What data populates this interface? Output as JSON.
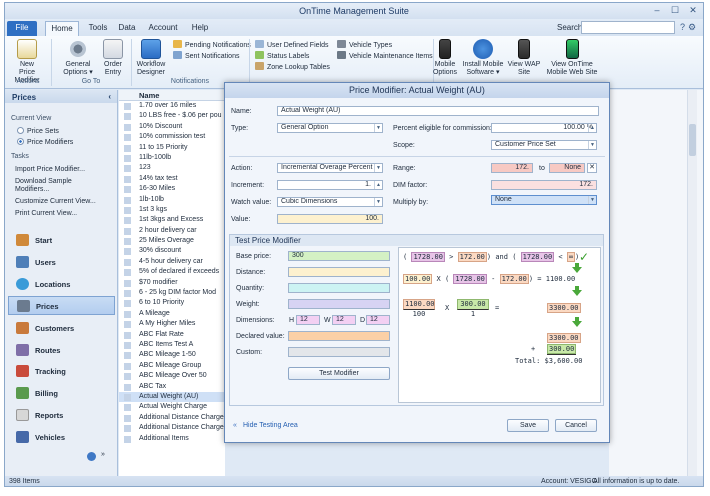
{
  "window": {
    "title": "OnTime Management Suite"
  },
  "menu": {
    "tabs": [
      "File",
      "Home",
      "Tools",
      "Data",
      "Account",
      "Help"
    ],
    "search_label": "Search:"
  },
  "ribbon": {
    "new_price_modifier": "New\nPrice Modifier",
    "general_options": "General\nOptions ▾",
    "order_entry": "Order\nEntry",
    "workflow_designer": "Workflow\nDesigner",
    "pending_notifications": "Pending Notifications",
    "sent_notifications": "Sent Notifications",
    "user_defined_fields": "User Defined Fields",
    "status_labels": "Status Labels",
    "zone_lookup_tables": "Zone Lookup Tables",
    "vehicle_types": "Vehicle Types",
    "vehicle_maintenance_items": "Vehicle Maintenance Items",
    "mobile_options": "Mobile\nOptions",
    "install_mobile_software": "Install Mobile\nSoftware ▾",
    "view_wap_site": "View WAP\nSite",
    "view_ontime_mobile_web_site": "View OnTime\nMobile Web Site",
    "groups": {
      "actions": "Actions",
      "go_to": "Go To",
      "notifications": "Notifications"
    }
  },
  "left_panel": {
    "header": "Prices",
    "current_view_label": "Current View",
    "views": [
      "Price Sets",
      "Price Modifiers"
    ],
    "tasks_label": "Tasks",
    "tasks": [
      "Import Price Modifier...",
      "Download Sample\nModifiers...",
      "Customize Current View...",
      "Print Current View..."
    ],
    "nav": [
      "Start",
      "Users",
      "Locations",
      "Prices",
      "Customers",
      "Routes",
      "Tracking",
      "Billing",
      "Reports",
      "Vehicles"
    ],
    "active_nav": "Prices"
  },
  "list": {
    "column": "Name",
    "rows": [
      "1.70 over 16 miles",
      "10 LBS free - $.06 per pou",
      "10%  Discount",
      "10% commission test",
      "11 to 15 Priority",
      "11lb-100lb",
      "123",
      "14% tax test",
      "16-30 Miles",
      "1lb-10lb",
      "1st 3 kgs",
      "1st 3kgs and Excess",
      "2 hour delivery car",
      "25 Miles Overage",
      "30% discount",
      "4-5 hour delivery car",
      "5% of declared if exceeds",
      "$70 modifier",
      "6 - 25 kg DIM factor Mod",
      "6 to 10 Priority",
      "A Mileage",
      "A My Higher Miles",
      "ABC Flat Rate",
      "ABC Items Test A",
      "ABC Mileage 1-50",
      "ABC Mileage Group",
      "ABC Mileage Over 50",
      "ABC Tax",
      "Actual Weight (AU)",
      "Actual Weight Charge",
      "Additional Distance Charges (Over 10)",
      "Additional Distance Charges (Over 10)",
      "Additional Items"
    ]
  },
  "status_bar": {
    "items": "398 Items",
    "account": "Account: VESIGO",
    "info": "All information is up to date."
  },
  "dialog": {
    "title": "Price Modifier: Actual Weight (AU)",
    "name_label": "Name:",
    "name_value": "Actual Weight (AU)",
    "type_label": "Type:",
    "type_value": "General Option",
    "commission_label": "Percent eligible for commission:",
    "commission_value": "100.00 %",
    "scope_label": "Scope:",
    "scope_value": "Customer Price Set",
    "action_label": "Action:",
    "action_value": "Incremental Overage Percent",
    "range_label": "Range:",
    "range_from": "172.",
    "range_to_label": "to",
    "range_to": "None",
    "increment_label": "Increment:",
    "increment_value": "1.",
    "dim_label": "DIM factor:",
    "dim_value": "172.",
    "watch_label": "Watch value:",
    "watch_value": "Cubic Dimensions",
    "multiply_label": "Multiply by:",
    "multiply_value": "None",
    "value_label": "Value:",
    "value_value": "100.",
    "test": {
      "header": "Test Price Modifier",
      "base_price_label": "Base price:",
      "base_price_value": "300",
      "distance_label": "Distance:",
      "quantity_label": "Quantity:",
      "weight_label": "Weight:",
      "dimensions_label": "Dimensions:",
      "h_label": "H",
      "h_value": "12",
      "w_label": "W",
      "w_value": "12",
      "d_label": "D",
      "d_value": "12",
      "declared_label": "Declared value:",
      "custom_label": "Custom:",
      "button": "Test Modifier",
      "calc": {
        "l1_a": "1728.00",
        "l1_gt": ">",
        "l1_b": "172.00",
        "l1_and": "and",
        "l1_c": "1728.00",
        "l1_lt": "<",
        "l1_d": "∞",
        "l1_check": "✓",
        "l2_a": "100.00",
        "l2_x": "X",
        "l2_b": "1728.00",
        "l2_minus": "-",
        "l2_c": "172.00",
        "l2_eq": "= 1100.00",
        "l3_num": "1100.00",
        "l3_den": "100",
        "l3_x": "X",
        "l3_num2": "300.00",
        "l3_den2": "1",
        "l3_eq": "=",
        "l3_res": "3300.00",
        "l4_a": "3300.00",
        "l4_plus": "+",
        "l4_b": "300.00",
        "l4_total": "Total: $3,600.00"
      }
    },
    "hide_testing": "Hide Testing Area",
    "save": "Save",
    "cancel": "Cancel"
  }
}
